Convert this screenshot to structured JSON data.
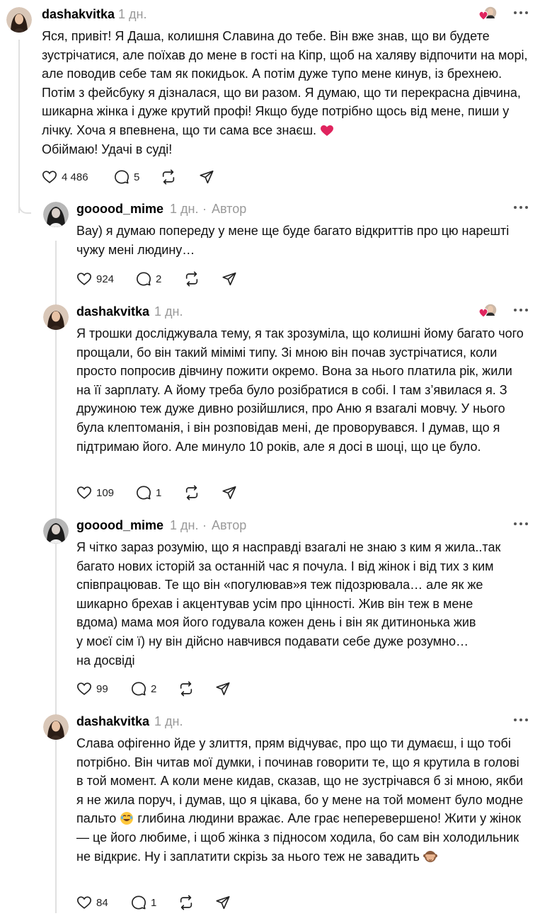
{
  "comments": [
    {
      "username": "dashakvitka",
      "time": "1 дн.",
      "author_tag": "",
      "text_parts": [
        "Яся, привіт! Я Даша, колишня Славина до тебе. Він вже знав, що ви будете зустрічатися, але поїхав до мене в гості на Кіпр, щоб на халяву відпочити на морі, але поводив себе там як покидьок. А потім дуже тупо мене кинув, із брехнею. Потім з фейсбуку я дізналася, що ви разом. Я думаю, що ти перекрасна дівчина, шикарна жінка і дуже крутий профі! Якщо буде потрібно щось від мене, пиши у лічку. Хоча я впевнена, що ти сама все знаєш.",
        "Обіймаю! Удачі в суді!"
      ],
      "likes": "4 486",
      "replies": "5"
    },
    {
      "username": "gooood_mime",
      "time": "1 дн.",
      "author_tag": "Автор",
      "text": "Вау) я думаю попереду у мене ще буде багато відкриттів про цю нарешті чужу мені людину…",
      "likes": "924",
      "replies": "2"
    },
    {
      "username": "dashakvitka",
      "time": "1 дн.",
      "author_tag": "",
      "text": "Я трошки досліджувала тему, я так зрозуміла, що колишні йому багато чого прощали, бо він такий мімімі типу. Зі мною він почав зустрічатися, коли просто попросив дівчину пожити окремо. Вона за нього платила рік, жили на її зарплату. А йому треба було розібратися в собі. І там з’явилася я. З дружиною теж дуже дивно розійшлися, про Аню я взагалі мовчу. У нього була клептоманія, і він розповідав мені, де проворувався. І думав, що я підтримаю його. Але минуло 10 років, але я досі в шоці, що це було.",
      "likes": "109",
      "replies": "1"
    },
    {
      "username": "gooood_mime",
      "time": "1 дн.",
      "author_tag": "Автор",
      "text_lines": [
        "Я чітко зараз розумію, що я насправді взагалі не знаю з ким я жила..так",
        "багато нових історій за останній час я почула. І від жінок і від тих з ким",
        "співпрацював. Те що він «погулював»я теж підозрювала… але як же",
        "шикарно брехав і акцентував усім про цінності. Жив він теж в мене",
        "вдома) мама моя його годувала кожен день і він як дитинонька жив",
        "у моєї сім ї) ну він дійсно навчився подавати себе дуже розумно…",
        "на досвіді"
      ],
      "likes": "99",
      "replies": "2"
    },
    {
      "username": "dashakvitka",
      "time": "1 дн.",
      "author_tag": "",
      "text_a": "Слава офігенно йде у злиття, прям відчуває, про що ти думаєш, і що тобі потрібно. Він читав мої думки, і починав говорити те, що я крутила в голові в той момент. А коли мене кидав, сказав, що не зустрічався б зі мною, якби я не жила поруч, і думав, що я цікава, бо у мене на той момент було модне пальто",
      "text_b": "глибина людини вражає. Але грає неперевершено! Жити у жінок — це його любиме, і щоб жінка з підносом ходила, бо сам він холодильник не відкриє. Ну і заплатити скрізь за нього теж не завадить",
      "likes": "84",
      "replies": "1"
    }
  ],
  "colors": {
    "meta": "#999999",
    "text": "#111111",
    "heart": "#e0245e",
    "line": "#e0e0e0"
  },
  "icons": [
    "heart-icon",
    "comment-icon",
    "repost-icon",
    "share-icon",
    "more-icon"
  ]
}
